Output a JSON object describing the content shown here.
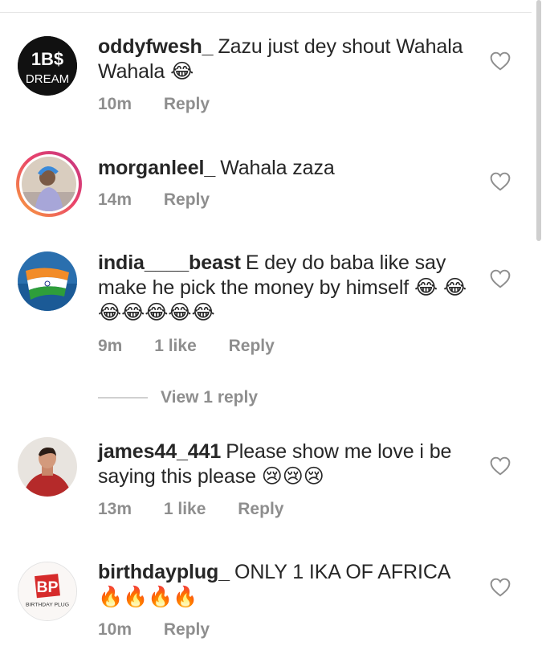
{
  "comments": [
    {
      "username": "oddyfwesh_",
      "text": "Zazu just dey shout Wahala Wahala 😂",
      "time": "10m",
      "likes": "",
      "reply": "Reply",
      "avatar": {
        "line1": "1B$",
        "line2": "DREAM",
        "bg": "#111111"
      }
    },
    {
      "username": "morganleel_",
      "text": "Wahala zaza",
      "time": "14m",
      "likes": "",
      "reply": "Reply"
    },
    {
      "username": "india____beast",
      "text": "E dey do baba like say make he pick the money by himself 😂 😂😂😂😂😂😂",
      "time": "9m",
      "likes": "1 like",
      "reply": "Reply",
      "view_replies": "View 1 reply"
    },
    {
      "username": "james44_441",
      "text": "Please show me love i be saying this please 😢😢😢",
      "time": "13m",
      "likes": "1 like",
      "reply": "Reply"
    },
    {
      "username": "birthdayplug_",
      "text": "ONLY 1 IKA OF AFRICA 🔥🔥🔥🔥",
      "time": "10m",
      "likes": "",
      "reply": "Reply",
      "avatar": {
        "logo": "BP",
        "caption": "BIRTHDAY PLUG"
      }
    }
  ],
  "icons": {
    "like": "heart-outline-icon"
  },
  "colors": {
    "text": "#262626",
    "meta": "#8e8e8e",
    "ring_start": "#f9a33b",
    "ring_end": "#c13584"
  }
}
